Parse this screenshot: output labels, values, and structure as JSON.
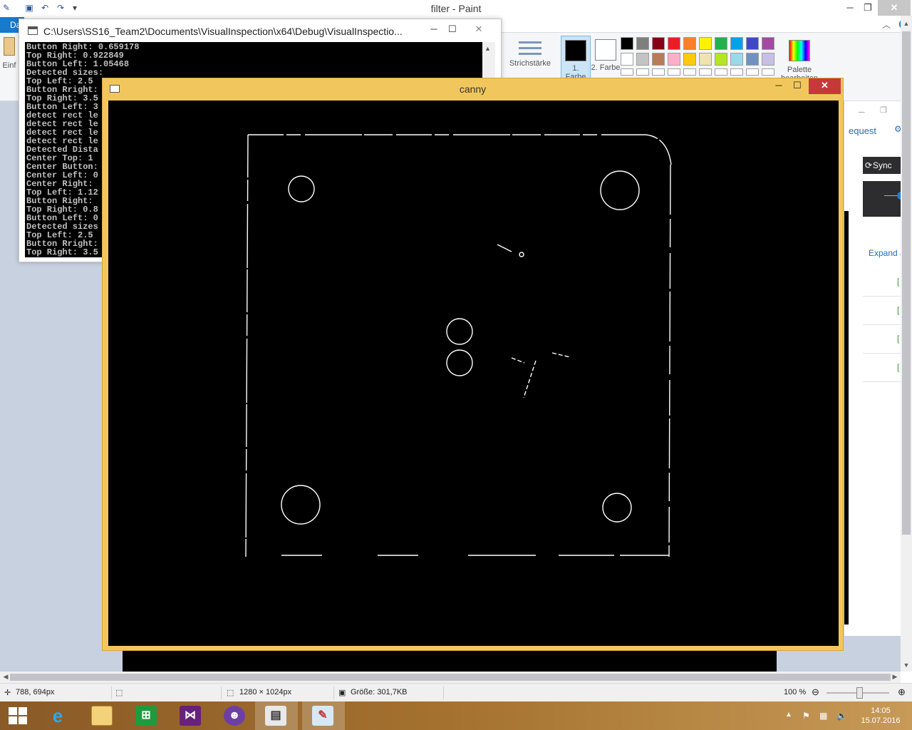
{
  "paint": {
    "title": "filter - Paint",
    "file_tab": "Da",
    "left_label": "Einf",
    "help": "?",
    "stroke_label": "Strichstärke",
    "color1_label": "1. Farbe",
    "color2_label": "2. Farbe",
    "edit_colors_label": "Palette bearbeiten",
    "palette_row1": [
      "#000000",
      "#7f7f7f",
      "#880015",
      "#ed1c24",
      "#ff7f27",
      "#fff200",
      "#22b14c",
      "#00a2e8",
      "#3f48cc",
      "#a349a4"
    ],
    "palette_row2": [
      "#ffffff",
      "#c3c3c3",
      "#b97a57",
      "#ffaec9",
      "#ffc90e",
      "#efe4b0",
      "#b5e61d",
      "#99d9ea",
      "#7092be",
      "#c8bfe7"
    ],
    "status": {
      "cursor_pos": "788, 694px",
      "image_size": "1280 × 1024px",
      "file_size": "Größe: 301,7KB",
      "zoom": "100 %"
    }
  },
  "background_app": {
    "request_text": "equest",
    "sync_label": "Sync",
    "expand_label": "Expand a"
  },
  "console": {
    "title": "C:\\Users\\SS16_Team2\\Documents\\VisualInspection\\x64\\Debug\\VisualInspectio...",
    "lines_full": [
      "Button Right: 0.659178",
      "Top Right: 0.922849",
      "Button Left: 1.05468",
      "Detected sizes:"
    ],
    "lines_cut": [
      "Top Left: 2.5",
      "Button Rright:",
      "Top Right: 3.5",
      "Button Left: 3",
      "detect rect le",
      "detect rect le",
      "detect rect le",
      "detect rect le",
      "Detected Dista",
      "Center Top: 1",
      "Center Button:",
      "Center Left: 0",
      "Center Right: ",
      "Top Left: 1.12",
      "Button Right: ",
      "Top Right: 0.8",
      "Button Left: 0",
      "Detected sizes",
      "Top Left: 2.5",
      "Button Rright:",
      "Top Right: 3.5"
    ]
  },
  "canny": {
    "title": "canny"
  },
  "taskbar": {
    "apps": [
      "start",
      "internet-explorer",
      "file-explorer",
      "store",
      "visual-studio",
      "github",
      "console-window",
      "paint"
    ],
    "time": "14:05",
    "date": "15.07.2016"
  },
  "colors": {
    "canny_border": "#f1c75d",
    "paint_file_tab": "#1979ca",
    "console_bg": "#000000",
    "edge_lines": "#ffffff"
  }
}
